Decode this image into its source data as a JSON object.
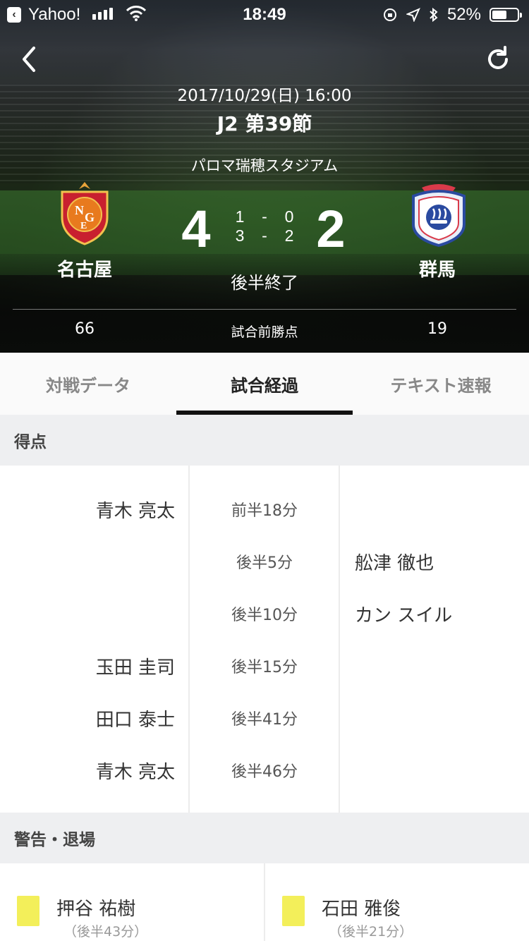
{
  "status_bar": {
    "back_app": "Yahoo!",
    "time": "18:49",
    "battery": "52%",
    "battery_level": 0.52,
    "signal_bars": 4
  },
  "match": {
    "date": "2017/10/29(日) 16:00",
    "round": "J2 第39節",
    "venue": "パロマ瑞穂スタジアム",
    "home": {
      "name": "名古屋",
      "score": "4",
      "points": "66",
      "logo": "nagoya-grampus-crest-icon"
    },
    "away": {
      "name": "群馬",
      "score": "2",
      "points": "19",
      "logo": "thespa-kusatsu-crest-icon"
    },
    "first_half": {
      "home": "1",
      "sep": "-",
      "away": "0"
    },
    "second_half": {
      "home": "3",
      "sep": "-",
      "away": "2"
    },
    "status": "後半終了",
    "points_label": "試合前勝点"
  },
  "tabs": [
    {
      "label": "対戦データ",
      "active": false
    },
    {
      "label": "試合経過",
      "active": true
    },
    {
      "label": "テキスト速報",
      "active": false
    }
  ],
  "goals": {
    "title": "得点",
    "rows": [
      {
        "home": "青木 亮太",
        "time": "前半18分",
        "away": ""
      },
      {
        "home": "",
        "time": "後半5分",
        "away": "舩津 徹也"
      },
      {
        "home": "",
        "time": "後半10分",
        "away": "カン スイル"
      },
      {
        "home": "玉田 圭司",
        "time": "後半15分",
        "away": ""
      },
      {
        "home": "田口 泰士",
        "time": "後半41分",
        "away": ""
      },
      {
        "home": "青木 亮太",
        "time": "後半46分",
        "away": ""
      }
    ]
  },
  "cards": {
    "title": "警告・退場",
    "home": {
      "name": "押谷 祐樹",
      "time": "（後半43分）",
      "type": "yellow"
    },
    "away": {
      "name": "石田 雅俊",
      "time": "（後半21分）",
      "type": "yellow"
    },
    "colors": {
      "yellow": "#f3ef5a"
    }
  }
}
